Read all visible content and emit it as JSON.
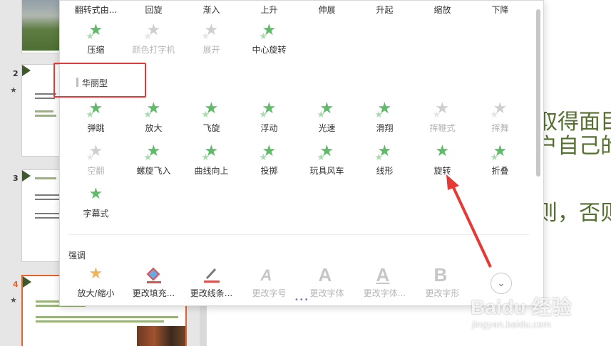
{
  "slides": [
    {
      "number": "2",
      "star": "★"
    },
    {
      "number": "3",
      "star": ""
    },
    {
      "number": "4",
      "star": "★"
    }
  ],
  "main_text": {
    "line1": "取得面目",
    "line2": "户自己的",
    "line3": "则，否则",
    "line4": "。"
  },
  "popup": {
    "top_row": [
      "翻转式由...",
      "回旋",
      "渐入",
      "上升",
      "伸展",
      "升起",
      "缩放",
      "下降"
    ],
    "row_moderate": [
      {
        "label": "压缩",
        "disabled": false
      },
      {
        "label": "颜色打字机",
        "disabled": true
      },
      {
        "label": "展开",
        "disabled": true
      },
      {
        "label": "中心旋转",
        "disabled": false
      }
    ],
    "section_fancy": "华丽型",
    "fancy_row1": [
      {
        "label": "弹跳",
        "disabled": false
      },
      {
        "label": "放大",
        "disabled": false
      },
      {
        "label": "飞旋",
        "disabled": false
      },
      {
        "label": "浮动",
        "disabled": false
      },
      {
        "label": "光速",
        "disabled": false
      },
      {
        "label": "滑翔",
        "disabled": false
      },
      {
        "label": "挥鞭式",
        "disabled": true
      },
      {
        "label": "挥舞",
        "disabled": true
      }
    ],
    "fancy_row2": [
      {
        "label": "空翻",
        "disabled": true
      },
      {
        "label": "螺旋飞入",
        "disabled": false
      },
      {
        "label": "曲线向上",
        "disabled": false
      },
      {
        "label": "投掷",
        "disabled": false
      },
      {
        "label": "玩具风车",
        "disabled": false
      },
      {
        "label": "线形",
        "disabled": false
      },
      {
        "label": "旋转",
        "disabled": false
      },
      {
        "label": "折叠",
        "disabled": false
      }
    ],
    "fancy_row3": [
      {
        "label": "字幕式",
        "disabled": false
      }
    ],
    "section_emphasis": "强调",
    "emphasis_row": [
      {
        "label": "放大/缩小",
        "disabled": false,
        "icon": "star-pair-icon"
      },
      {
        "label": "更改填充...",
        "disabled": false,
        "icon": "fill-bucket-icon"
      },
      {
        "label": "更改线条...",
        "disabled": false,
        "icon": "pen-line-icon"
      },
      {
        "label": "更改字号",
        "disabled": true,
        "icon": "font-size-icon"
      },
      {
        "label": "更改字体",
        "disabled": true,
        "icon": "font-icon"
      },
      {
        "label": "更改字体...",
        "disabled": true,
        "icon": "font-color-icon"
      },
      {
        "label": "更改字形",
        "disabled": true,
        "icon": "font-style-icon"
      }
    ],
    "expand_glyph": "⌄",
    "dots": "•••"
  },
  "watermark": {
    "brand": "Baidu 经验",
    "url": "jingyan.baidu.com"
  },
  "colors": {
    "accent_green": "#5fba6a",
    "highlight_red": "#e53935",
    "active_slide": "#e2632e",
    "slide_text": "#55702e"
  }
}
